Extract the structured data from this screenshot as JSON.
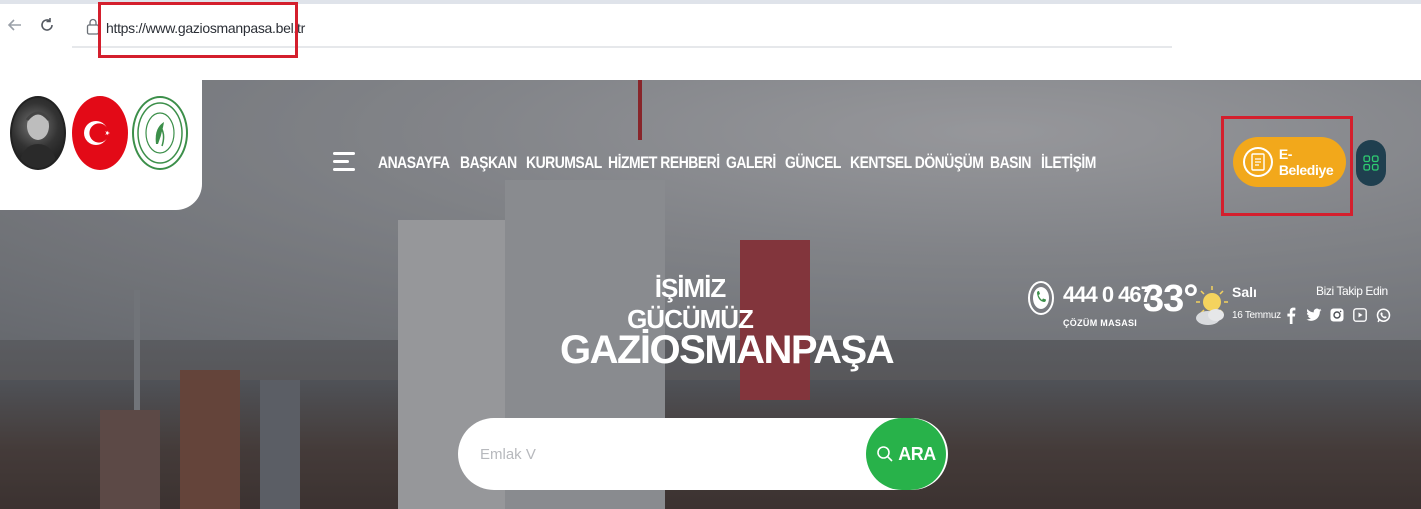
{
  "browser": {
    "url": "https://www.gaziosmanpasa.bel.tr"
  },
  "nav": {
    "items": [
      {
        "label": "ANASAYFA"
      },
      {
        "label": "BAŞKAN"
      },
      {
        "label": "KURUMSAL"
      },
      {
        "label": "HİZMET REHBERİ"
      },
      {
        "label": "GALERİ"
      },
      {
        "label": "GÜNCEL"
      },
      {
        "label": "KENTSEL DÖNÜŞÜM"
      },
      {
        "label": "BASIN"
      },
      {
        "label": "İLETİŞİM"
      }
    ]
  },
  "ebelediye": {
    "label": "E-Belediye"
  },
  "hero": {
    "tagline": "İŞİMİZ GÜCÜMÜZ",
    "title": "GAZİOSMANPAŞA"
  },
  "search": {
    "value": "Emlak V",
    "button_label": "ARA"
  },
  "info": {
    "hotline_number": "444 0 467",
    "hotline_label": "ÇÖZÜM MASASI",
    "temperature": "33°",
    "day": "Salı",
    "date": "16 Temmuz",
    "follow_label": "Bizi Takip Edin"
  },
  "colors": {
    "highlight": "#d41f2d",
    "ebelediye_button": "#f2a81b",
    "search_button": "#28b24a",
    "apps_button": "#1f3f4f"
  },
  "icons": {
    "social": [
      "facebook-icon",
      "twitter-icon",
      "instagram-icon",
      "youtube-icon",
      "whatsapp-icon"
    ]
  }
}
